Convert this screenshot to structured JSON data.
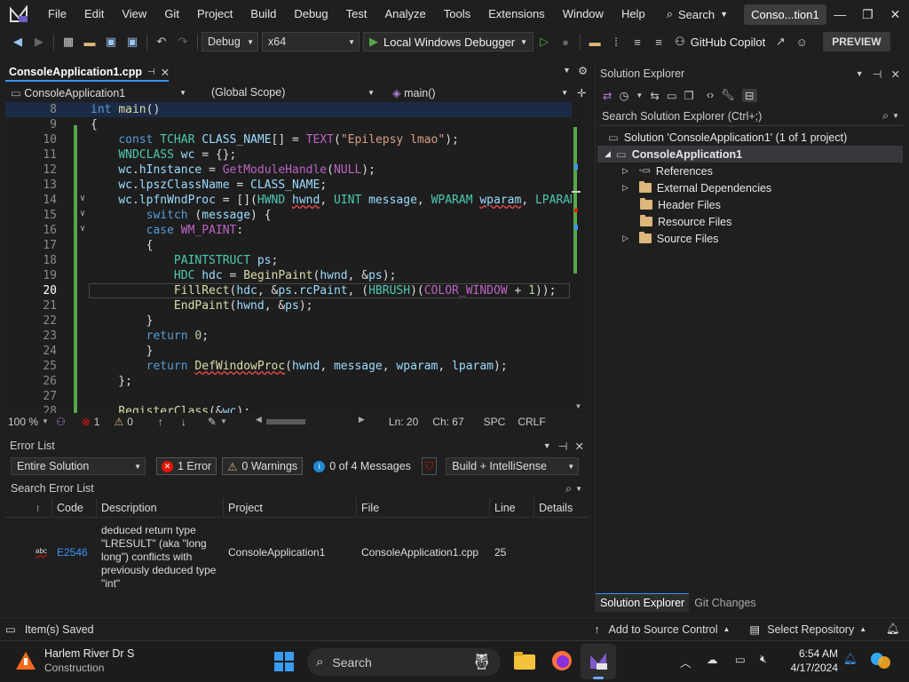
{
  "menubar": {
    "items": [
      "File",
      "Edit",
      "View",
      "Git",
      "Project",
      "Build",
      "Debug",
      "Test",
      "Analyze",
      "Tools",
      "Extensions",
      "Window",
      "Help"
    ],
    "search_label": "Search",
    "solution_name": "Conso...tion1"
  },
  "toolbar": {
    "config": "Debug",
    "platform": "x64",
    "run_label": "Local Windows Debugger",
    "copilot_label": "GitHub Copilot",
    "preview_label": "PREVIEW"
  },
  "editor": {
    "tab_label": "ConsoleApplication1.cpp",
    "nav_project": "ConsoleApplication1",
    "nav_scope": "(Global Scope)",
    "nav_member": "main()",
    "line_numbers": [
      "8",
      "9",
      "10",
      "11",
      "12",
      "13",
      "14",
      "15",
      "16",
      "17",
      "18",
      "19",
      "20",
      "21",
      "22",
      "23",
      "24",
      "25",
      "26",
      "27",
      "28"
    ],
    "zoom": "100 %",
    "errors_count": "1",
    "warnings_count": "0",
    "line_label": "Ln: 20",
    "col_label": "Ch: 67",
    "spacing": "SPC",
    "line_ending": "CRLF"
  },
  "error_list": {
    "title": "Error List",
    "scope": "Entire Solution",
    "errors_label": "1 Error",
    "warnings_label": "0 Warnings",
    "messages_label": "0 of 4 Messages",
    "build_filter": "Build + IntelliSense",
    "search_placeholder": "Search Error List",
    "columns": [
      "Code",
      "Description",
      "Project",
      "File",
      "Line",
      "Details"
    ],
    "rows": [
      {
        "code": "E2546",
        "description": "deduced return type \"LRESULT\" (aka \"long long\") conflicts with previously deduced type \"int\"",
        "project": "ConsoleApplication1",
        "file": "ConsoleApplication1.cpp",
        "line": "25",
        "details": ""
      }
    ]
  },
  "solution_explorer": {
    "title": "Solution Explorer",
    "search_placeholder": "Search Solution Explorer (Ctrl+;)",
    "solution_label": "Solution 'ConsoleApplication1' (1 of 1 project)",
    "project_label": "ConsoleApplication1",
    "nodes": [
      "References",
      "External Dependencies",
      "Header Files",
      "Resource Files",
      "Source Files"
    ],
    "tab_solution": "Solution Explorer",
    "tab_git": "Git Changes"
  },
  "statusbar": {
    "message": "Item(s) Saved",
    "source_control": "Add to Source Control",
    "repository": "Select Repository"
  },
  "taskbar": {
    "weather_title": "Harlem River Dr S",
    "weather_sub": "Construction",
    "search_label": "Search",
    "time": "6:54 AM",
    "date": "4/17/2024"
  },
  "colors": {
    "accent": "#3794ff",
    "error": "#e51400",
    "green_bar": "#57a64a"
  }
}
